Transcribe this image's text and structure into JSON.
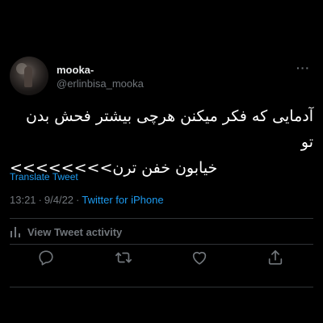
{
  "tweet": {
    "display_name": "mooka-",
    "handle": "@erlinbisa_mooka",
    "more_icon": "more-horizontal-icon",
    "text_line1": "آدمایی که فکر میکنن هرچی بیشتر فحش بدن تو",
    "text_line2": "خیابون خفن ترن>>>>>>>>",
    "translate_label": "Translate Tweet",
    "time": "13:21",
    "date": "9/4/22",
    "source": "Twitter for iPhone"
  },
  "activity": {
    "label": "View Tweet activity",
    "icon": "analytics-bars-icon"
  },
  "actions": {
    "reply_icon": "reply-bubble-icon",
    "retweet_icon": "retweet-icon",
    "like_icon": "heart-icon",
    "share_icon": "share-upload-icon"
  },
  "colors": {
    "background": "#000000",
    "text_primary": "#e7e9ea",
    "text_secondary": "#71767b",
    "link": "#1d9bf0",
    "divider": "#2f3336"
  }
}
